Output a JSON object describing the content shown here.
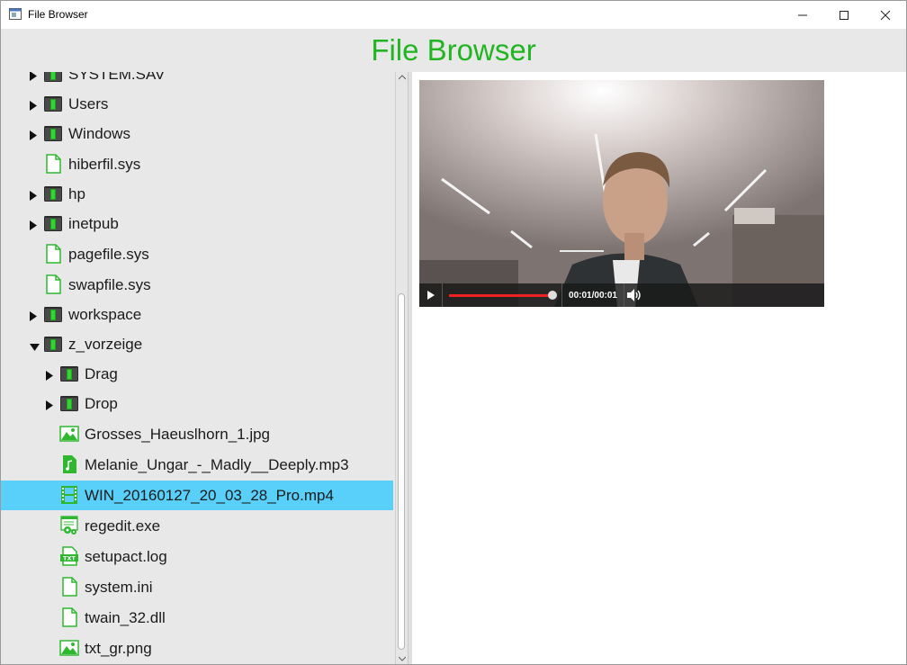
{
  "window": {
    "title": "File Browser"
  },
  "header": {
    "title": "File Browser"
  },
  "tree": {
    "items": [
      {
        "label": "SYSTEM.SAV",
        "type": "folder",
        "depth": 0,
        "expanded": false
      },
      {
        "label": "Users",
        "type": "folder",
        "depth": 0,
        "expanded": false
      },
      {
        "label": "Windows",
        "type": "folder",
        "depth": 0,
        "expanded": false
      },
      {
        "label": "hiberfil.sys",
        "type": "file",
        "depth": 0
      },
      {
        "label": "hp",
        "type": "folder",
        "depth": 0,
        "expanded": false
      },
      {
        "label": "inetpub",
        "type": "folder",
        "depth": 0,
        "expanded": false
      },
      {
        "label": "pagefile.sys",
        "type": "file",
        "depth": 0
      },
      {
        "label": "swapfile.sys",
        "type": "file",
        "depth": 0
      },
      {
        "label": "workspace",
        "type": "folder",
        "depth": 0,
        "expanded": false
      },
      {
        "label": "z_vorzeige",
        "type": "folder",
        "depth": 0,
        "expanded": true
      },
      {
        "label": "Drag",
        "type": "folder",
        "depth": 1,
        "expanded": false
      },
      {
        "label": "Drop",
        "type": "folder",
        "depth": 1,
        "expanded": false
      },
      {
        "label": "Grosses_Haeuslhorn_1.jpg",
        "type": "image",
        "depth": 1
      },
      {
        "label": "Melanie_Ungar_-_Madly__Deeply.mp3",
        "type": "audio",
        "depth": 1
      },
      {
        "label": "WIN_20160127_20_03_28_Pro.mp4",
        "type": "video",
        "depth": 1,
        "selected": true
      },
      {
        "label": "regedit.exe",
        "type": "exe",
        "depth": 1
      },
      {
        "label": "setupact.log",
        "type": "txt",
        "depth": 1
      },
      {
        "label": "system.ini",
        "type": "file",
        "depth": 1
      },
      {
        "label": "twain_32.dll",
        "type": "file",
        "depth": 1
      },
      {
        "label": "txt_gr.png",
        "type": "image",
        "depth": 1
      }
    ]
  },
  "player": {
    "time": "00:01/00:01",
    "progress": 1.0
  },
  "colors": {
    "accent": "#21b521",
    "selection": "#59d0f9",
    "seek": "#e22222"
  }
}
